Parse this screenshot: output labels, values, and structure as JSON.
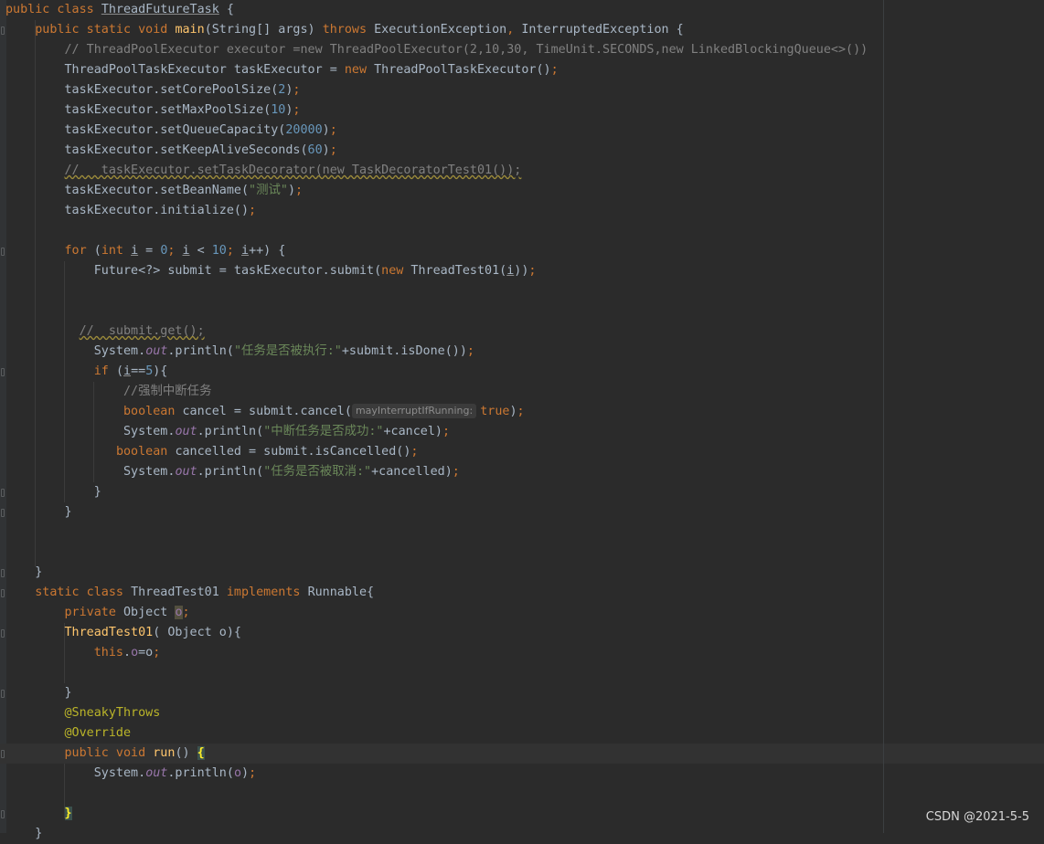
{
  "editor": {
    "language": "java",
    "theme_colors": {
      "background": "#2b2b2b",
      "keyword": "#cc7832",
      "identifier": "#a9b7c6",
      "method": "#ffc66d",
      "number": "#6897bb",
      "string": "#6a8759",
      "comment": "#808080",
      "annotation": "#bbb529",
      "field": "#9876aa"
    },
    "lines": [
      [
        {
          "t": "public class ",
          "c": "kw"
        },
        {
          "t": "ThreadFutureTask",
          "c": "id ul"
        },
        {
          "t": " {",
          "c": "id"
        }
      ],
      [
        {
          "t": "    public static void ",
          "c": "kw"
        },
        {
          "t": "main",
          "c": "fn"
        },
        {
          "t": "(String[] args) ",
          "c": "id"
        },
        {
          "t": "throws ",
          "c": "kw"
        },
        {
          "t": "ExecutionException",
          "c": "id"
        },
        {
          "t": ", ",
          "c": "kw"
        },
        {
          "t": "InterruptedException {",
          "c": "id"
        }
      ],
      [
        {
          "t": "        // ThreadPoolExecutor executor =new ThreadPoolExecutor(2,10,30, TimeUnit.SECONDS,new LinkedBlockingQueue<>())",
          "c": "cmt"
        }
      ],
      [
        {
          "t": "        ThreadPoolTaskExecutor taskExecutor = ",
          "c": "id"
        },
        {
          "t": "new ",
          "c": "kw"
        },
        {
          "t": "ThreadPoolTaskExecutor()",
          "c": "id"
        },
        {
          "t": ";",
          "c": "kw"
        }
      ],
      [
        {
          "t": "        taskExecutor.setCorePoolSize(",
          "c": "id"
        },
        {
          "t": "2",
          "c": "num"
        },
        {
          "t": ")",
          "c": "id"
        },
        {
          "t": ";",
          "c": "kw"
        }
      ],
      [
        {
          "t": "        taskExecutor.setMaxPoolSize(",
          "c": "id"
        },
        {
          "t": "10",
          "c": "num"
        },
        {
          "t": ")",
          "c": "id"
        },
        {
          "t": ";",
          "c": "kw"
        }
      ],
      [
        {
          "t": "        taskExecutor.setQueueCapacity(",
          "c": "id"
        },
        {
          "t": "20000",
          "c": "num"
        },
        {
          "t": ")",
          "c": "id"
        },
        {
          "t": ";",
          "c": "kw"
        }
      ],
      [
        {
          "t": "        taskExecutor.setKeepAliveSeconds(",
          "c": "id"
        },
        {
          "t": "60",
          "c": "num"
        },
        {
          "t": ")",
          "c": "id"
        },
        {
          "t": ";",
          "c": "kw"
        }
      ],
      [
        {
          "t": "        ",
          "c": "id"
        },
        {
          "t": "//   taskExecutor.setTaskDecorator(new TaskDecoratorTest01());",
          "c": "cmt warn"
        }
      ],
      [
        {
          "t": "        taskExecutor.setBeanName(",
          "c": "id"
        },
        {
          "t": "\"测试\"",
          "c": "str"
        },
        {
          "t": ")",
          "c": "id"
        },
        {
          "t": ";",
          "c": "kw"
        }
      ],
      [
        {
          "t": "        taskExecutor.initialize()",
          "c": "id"
        },
        {
          "t": ";",
          "c": "kw"
        }
      ],
      [],
      [
        {
          "t": "        ",
          "c": "id"
        },
        {
          "t": "for ",
          "c": "kw"
        },
        {
          "t": "(",
          "c": "id"
        },
        {
          "t": "int ",
          "c": "kw"
        },
        {
          "t": "i",
          "c": "id ul"
        },
        {
          "t": " = ",
          "c": "id"
        },
        {
          "t": "0",
          "c": "num"
        },
        {
          "t": "; ",
          "c": "kw"
        },
        {
          "t": "i",
          "c": "id ul"
        },
        {
          "t": " < ",
          "c": "id"
        },
        {
          "t": "10",
          "c": "num"
        },
        {
          "t": "; ",
          "c": "kw"
        },
        {
          "t": "i",
          "c": "id ul"
        },
        {
          "t": "++) {",
          "c": "id"
        }
      ],
      [
        {
          "t": "            Future<?> submit = taskExecutor.submit(",
          "c": "id"
        },
        {
          "t": "new ",
          "c": "kw"
        },
        {
          "t": "ThreadTest01(",
          "c": "id"
        },
        {
          "t": "i",
          "c": "id ul"
        },
        {
          "t": "))",
          "c": "id"
        },
        {
          "t": ";",
          "c": "kw"
        }
      ],
      [],
      [],
      [
        {
          "t": "          ",
          "c": "id"
        },
        {
          "t": "//  submit.get();",
          "c": "cmt warn"
        }
      ],
      [
        {
          "t": "            System.",
          "c": "id"
        },
        {
          "t": "out",
          "c": "fld"
        },
        {
          "t": ".println(",
          "c": "id"
        },
        {
          "t": "\"任务是否被执行:\"",
          "c": "str"
        },
        {
          "t": "+submit.isDone())",
          "c": "id"
        },
        {
          "t": ";",
          "c": "kw"
        }
      ],
      [
        {
          "t": "            ",
          "c": "id"
        },
        {
          "t": "if ",
          "c": "kw"
        },
        {
          "t": "(",
          "c": "id"
        },
        {
          "t": "i",
          "c": "id ul"
        },
        {
          "t": "==",
          "c": "id"
        },
        {
          "t": "5",
          "c": "num"
        },
        {
          "t": "){",
          "c": "id"
        }
      ],
      [
        {
          "t": "                //强制中断任务",
          "c": "cmt"
        }
      ],
      [
        {
          "t": "                ",
          "c": "id"
        },
        {
          "t": "boolean ",
          "c": "kw"
        },
        {
          "t": "cancel = submit.cancel(",
          "c": "id"
        },
        {
          "t": "mayInterruptIfRunning:",
          "c": "hint"
        },
        {
          "t": "true",
          "c": "kw"
        },
        {
          "t": ")",
          "c": "id"
        },
        {
          "t": ";",
          "c": "kw"
        }
      ],
      [
        {
          "t": "                System.",
          "c": "id"
        },
        {
          "t": "out",
          "c": "fld"
        },
        {
          "t": ".println(",
          "c": "id"
        },
        {
          "t": "\"中断任务是否成功:\"",
          "c": "str"
        },
        {
          "t": "+cancel)",
          "c": "id"
        },
        {
          "t": ";",
          "c": "kw"
        }
      ],
      [
        {
          "t": "               ",
          "c": "id"
        },
        {
          "t": "boolean ",
          "c": "kw"
        },
        {
          "t": "cancelled = submit.isCancelled()",
          "c": "id"
        },
        {
          "t": ";",
          "c": "kw"
        }
      ],
      [
        {
          "t": "                System.",
          "c": "id"
        },
        {
          "t": "out",
          "c": "fld"
        },
        {
          "t": ".println(",
          "c": "id"
        },
        {
          "t": "\"任务是否被取消:\"",
          "c": "str"
        },
        {
          "t": "+cancelled)",
          "c": "id"
        },
        {
          "t": ";",
          "c": "kw"
        }
      ],
      [
        {
          "t": "            }",
          "c": "id"
        }
      ],
      [
        {
          "t": "        }",
          "c": "id"
        }
      ],
      [],
      [],
      [
        {
          "t": "    }",
          "c": "id"
        }
      ],
      [
        {
          "t": "    static class ",
          "c": "kw"
        },
        {
          "t": "ThreadTest01 ",
          "c": "id"
        },
        {
          "t": "implements ",
          "c": "kw"
        },
        {
          "t": "Runnable{",
          "c": "id"
        }
      ],
      [
        {
          "t": "        private ",
          "c": "kw"
        },
        {
          "t": "Object ",
          "c": "id"
        },
        {
          "t": "o",
          "c": "plain-fld hl-var"
        },
        {
          "t": ";",
          "c": "kw"
        }
      ],
      [
        {
          "t": "        ",
          "c": "id"
        },
        {
          "t": "ThreadTest01",
          "c": "fn"
        },
        {
          "t": "( Object o){",
          "c": "id"
        }
      ],
      [
        {
          "t": "            ",
          "c": "id"
        },
        {
          "t": "this",
          "c": "kw"
        },
        {
          "t": ".",
          "c": "id"
        },
        {
          "t": "o",
          "c": "plain-fld"
        },
        {
          "t": "=o",
          "c": "id"
        },
        {
          "t": ";",
          "c": "kw"
        }
      ],
      [],
      [
        {
          "t": "        }",
          "c": "id"
        }
      ],
      [
        {
          "t": "        @SneakyThrows",
          "c": "ann"
        }
      ],
      [
        {
          "t": "        @Override",
          "c": "ann"
        }
      ],
      [
        {
          "t": "        ",
          "c": "id"
        },
        {
          "t": "public void ",
          "c": "kw"
        },
        {
          "t": "run",
          "c": "fn"
        },
        {
          "t": "() ",
          "c": "id"
        },
        {
          "t": "{",
          "c": "brace-hl"
        }
      ],
      [
        {
          "t": "            System.",
          "c": "id"
        },
        {
          "t": "out",
          "c": "fld"
        },
        {
          "t": ".println(",
          "c": "id"
        },
        {
          "t": "o",
          "c": "plain-fld"
        },
        {
          "t": ")",
          "c": "id"
        },
        {
          "t": ";",
          "c": "kw"
        }
      ],
      [],
      [
        {
          "t": "        ",
          "c": "id"
        },
        {
          "t": "}",
          "c": "brace-hl"
        }
      ],
      [
        {
          "t": "    }",
          "c": "id"
        }
      ]
    ]
  },
  "watermark": "CSDN @2021-5-5"
}
